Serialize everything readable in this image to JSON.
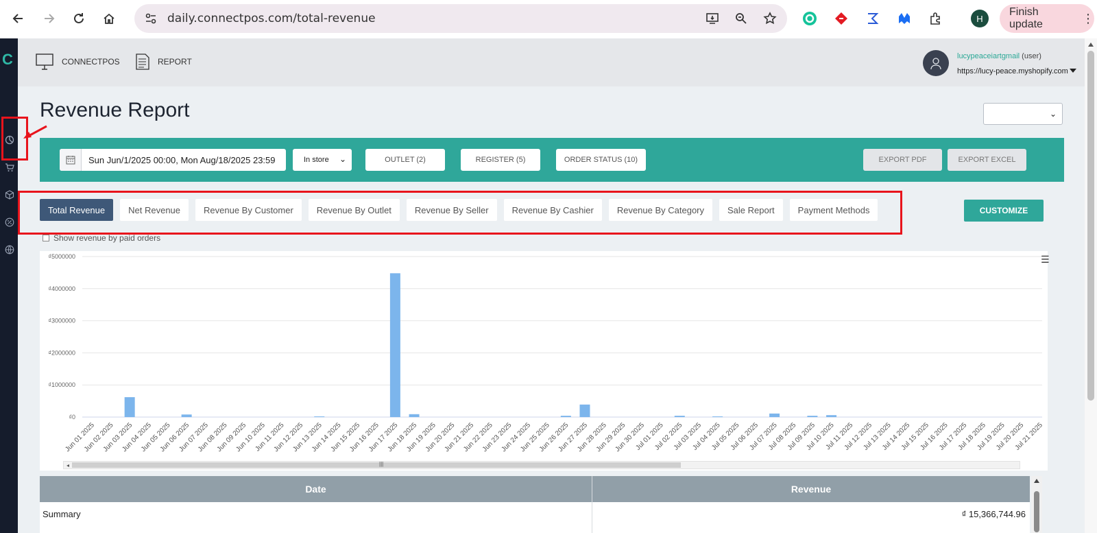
{
  "browser": {
    "url": "daily.connectpos.com/total-revenue",
    "profile_initial": "H",
    "finish_update_label": "Finish update"
  },
  "sidebar": {
    "logo_text": "C",
    "items": [
      {
        "icon": "pie-chart-icon"
      },
      {
        "icon": "cart-icon"
      },
      {
        "icon": "cube-icon"
      },
      {
        "icon": "percent-icon"
      },
      {
        "icon": "globe-icon"
      }
    ]
  },
  "header": {
    "connectpos_label": "CONNECTPOS",
    "report_label": "REPORT",
    "user_name": "lucypeaceiartgmail",
    "user_role": "(user)",
    "store_url": "https://lucy-peace.myshopify.com"
  },
  "page": {
    "title": "Revenue Report",
    "date_range": "Sun Jun/1/2025 00:00, Mon Aug/18/2025 23:59",
    "location_select": "In store",
    "outlet_label": "OUTLET (2)",
    "register_label": "REGISTER (5)",
    "order_status_label": "ORDER STATUS (10)",
    "export_pdf_label": "EXPORT PDF",
    "export_excel_label": "EXPORT EXCEL",
    "customize_label": "CUSTOMIZE",
    "paid_orders_label": "Show revenue by paid orders",
    "tabs": [
      {
        "label": "Total Revenue",
        "active": true
      },
      {
        "label": "Net Revenue"
      },
      {
        "label": "Revenue By Customer"
      },
      {
        "label": "Revenue By Outlet"
      },
      {
        "label": "Revenue By Seller"
      },
      {
        "label": "Revenue By Cashier"
      },
      {
        "label": "Revenue By Category"
      },
      {
        "label": "Sale Report"
      },
      {
        "label": "Payment Methods"
      }
    ]
  },
  "table": {
    "headers": [
      "Date",
      "Revenue"
    ],
    "summary_label": "Summary",
    "summary_value": "₫ 15,366,744.96"
  },
  "colors": {
    "accent": "#2fa79a",
    "active_tab": "#3e5878",
    "bar": "#7cb5ec",
    "annotation_red": "#e8141c"
  },
  "chart_data": {
    "type": "bar",
    "ylim": [
      0,
      5000000
    ],
    "y_ticks": [
      "₫0",
      "₫1000000",
      "₫2000000",
      "₫3000000",
      "₫4000000",
      "₫5000000"
    ],
    "grid": true,
    "categories": [
      "Jun 01 2025",
      "Jun 02 2025",
      "Jun 03 2025",
      "Jun 04 2025",
      "Jun 05 2025",
      "Jun 06 2025",
      "Jun 07 2025",
      "Jun 08 2025",
      "Jun 09 2025",
      "Jun 10 2025",
      "Jun 11 2025",
      "Jun 12 2025",
      "Jun 13 2025",
      "Jun 14 2025",
      "Jun 15 2025",
      "Jun 16 2025",
      "Jun 17 2025",
      "Jun 18 2025",
      "Jun 19 2025",
      "Jun 20 2025",
      "Jun 21 2025",
      "Jun 22 2025",
      "Jun 23 2025",
      "Jun 24 2025",
      "Jun 25 2025",
      "Jun 26 2025",
      "Jun 27 2025",
      "Jun 28 2025",
      "Jun 29 2025",
      "Jun 30 2025",
      "Jul 01 2025",
      "Jul 02 2025",
      "Jul 03 2025",
      "Jul 04 2025",
      "Jul 05 2025",
      "Jul 06 2025",
      "Jul 07 2025",
      "Jul 08 2025",
      "Jul 09 2025",
      "Jul 10 2025",
      "Jul 11 2025",
      "Jul 12 2025",
      "Jul 13 2025",
      "Jul 14 2025",
      "Jul 15 2025",
      "Jul 16 2025",
      "Jul 17 2025",
      "Jul 18 2025",
      "Jul 19 2025",
      "Jul 20 2025",
      "Jul 21 2025"
    ],
    "values": [
      0,
      0,
      620000,
      0,
      0,
      80000,
      0,
      0,
      0,
      0,
      0,
      0,
      20000,
      0,
      0,
      0,
      4480000,
      90000,
      0,
      0,
      0,
      0,
      0,
      0,
      0,
      40000,
      390000,
      0,
      0,
      0,
      0,
      40000,
      0,
      20000,
      0,
      0,
      110000,
      0,
      40000,
      60000,
      0,
      0,
      0,
      0,
      0,
      0,
      0,
      0,
      0,
      0,
      0
    ]
  }
}
